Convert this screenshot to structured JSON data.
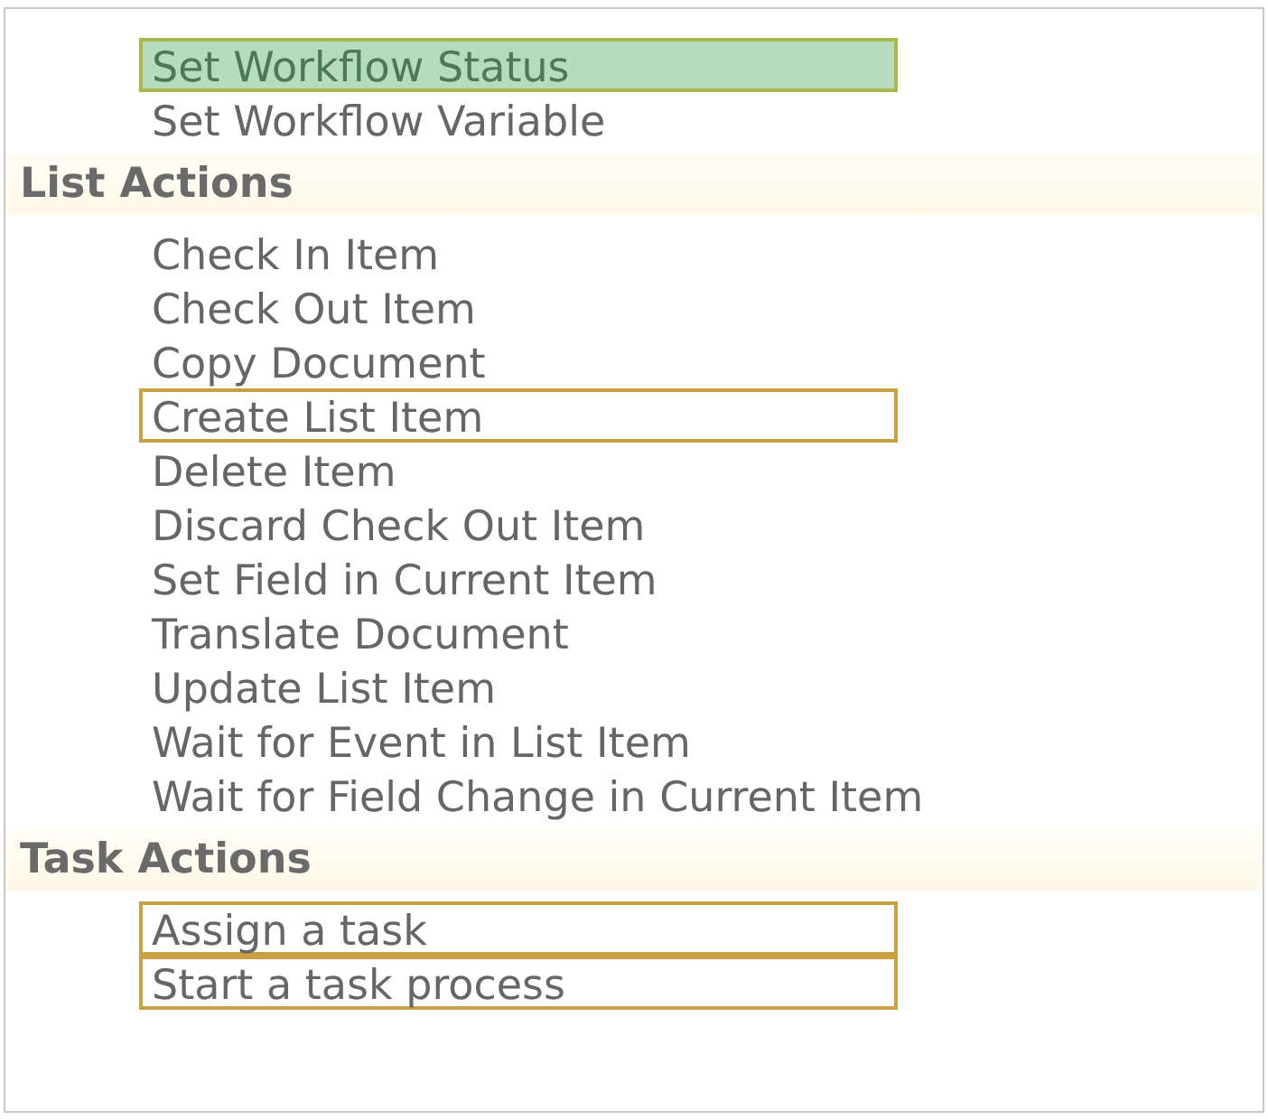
{
  "groups": [
    {
      "items": [
        {
          "label": "Set Workflow Status",
          "selected": true,
          "boxed": true
        },
        {
          "label": "Set Workflow Variable",
          "selected": false,
          "boxed": false
        }
      ]
    },
    {
      "title": "List Actions",
      "items": [
        {
          "label": "Check In Item",
          "selected": false,
          "boxed": false
        },
        {
          "label": "Check Out Item",
          "selected": false,
          "boxed": false
        },
        {
          "label": "Copy Document",
          "selected": false,
          "boxed": false
        },
        {
          "label": "Create List Item",
          "selected": false,
          "boxed": true
        },
        {
          "label": "Delete Item",
          "selected": false,
          "boxed": false
        },
        {
          "label": "Discard Check Out Item",
          "selected": false,
          "boxed": false
        },
        {
          "label": "Set Field in Current Item",
          "selected": false,
          "boxed": false
        },
        {
          "label": "Translate Document",
          "selected": false,
          "boxed": false
        },
        {
          "label": "Update List Item",
          "selected": false,
          "boxed": false
        },
        {
          "label": "Wait for Event in List Item",
          "selected": false,
          "boxed": false
        },
        {
          "label": "Wait for Field Change in Current Item",
          "selected": false,
          "boxed": false
        }
      ]
    },
    {
      "title": "Task Actions",
      "items": [
        {
          "label": "Assign a task",
          "selected": false,
          "boxed": true
        },
        {
          "label": "Start a task process",
          "selected": false,
          "boxed": true
        }
      ]
    }
  ]
}
